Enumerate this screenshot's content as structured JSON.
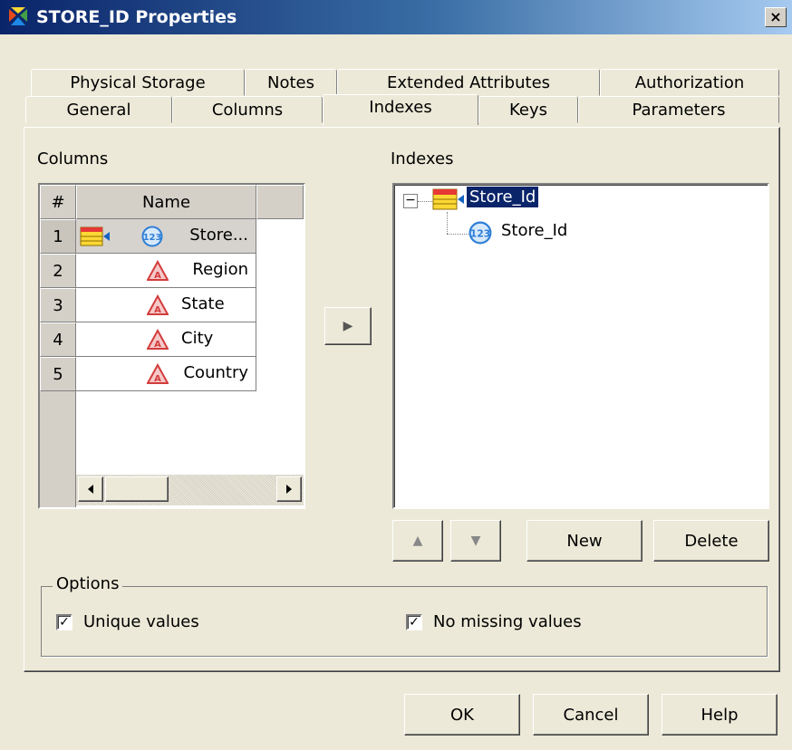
{
  "window": {
    "title": "STORE_ID Properties",
    "close_label": "×"
  },
  "tabs": {
    "back_row": [
      "Physical Storage",
      "Notes",
      "Extended Attributes",
      "Authorization"
    ],
    "front_row": [
      "General",
      "Columns",
      "Indexes",
      "Keys",
      "Parameters"
    ],
    "active": "Indexes"
  },
  "columns_panel": {
    "label": "Columns",
    "header_num": "#",
    "header_name": "Name",
    "rows": [
      {
        "num": "1",
        "name": "Store...",
        "type": "numeric-icon",
        "selected": true
      },
      {
        "num": "2",
        "name": "Region",
        "type": "character-icon"
      },
      {
        "num": "3",
        "name": "State",
        "type": "character-icon"
      },
      {
        "num": "4",
        "name": "City",
        "type": "character-icon"
      },
      {
        "num": "5",
        "name": "Country",
        "type": "character-icon"
      }
    ],
    "move_button": "▶"
  },
  "indexes_panel": {
    "label": "Indexes",
    "tree": {
      "expander": "⊟",
      "index_name": "Store_Id",
      "child_column": "Store_Id"
    },
    "buttons": {
      "up": "▲",
      "down": "▼",
      "new": "New",
      "delete": "Delete"
    }
  },
  "options": {
    "title": "Options",
    "unique_values": {
      "label": "Unique values",
      "checked": true
    },
    "no_missing_values": {
      "label": "No missing values",
      "checked": true
    }
  },
  "footer": {
    "ok": "OK",
    "cancel": "Cancel",
    "help": "Help"
  },
  "colors": {
    "title_gradient_start": "#0a246a",
    "title_gradient_end": "#a6caf0",
    "selection": "#0a246a",
    "numeric_icon": "#2f7fd6",
    "character_icon": "#d33c3c"
  }
}
